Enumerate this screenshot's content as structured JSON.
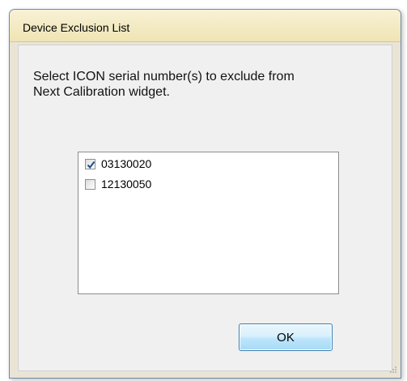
{
  "window": {
    "title": "Device Exclusion List"
  },
  "content": {
    "instructions": "Select ICON serial number(s) to exclude from\nNext Calibration widget."
  },
  "device_list": {
    "items": [
      {
        "label": "03130020",
        "checked": true
      },
      {
        "label": "12130050",
        "checked": false
      }
    ]
  },
  "buttons": {
    "ok_label": "OK"
  },
  "colors": {
    "title_bar": "#f3ebc4",
    "dialog_background": "#f0f0f0",
    "button_border": "#3c7fb1",
    "check_mark": "#1f4f8a"
  }
}
